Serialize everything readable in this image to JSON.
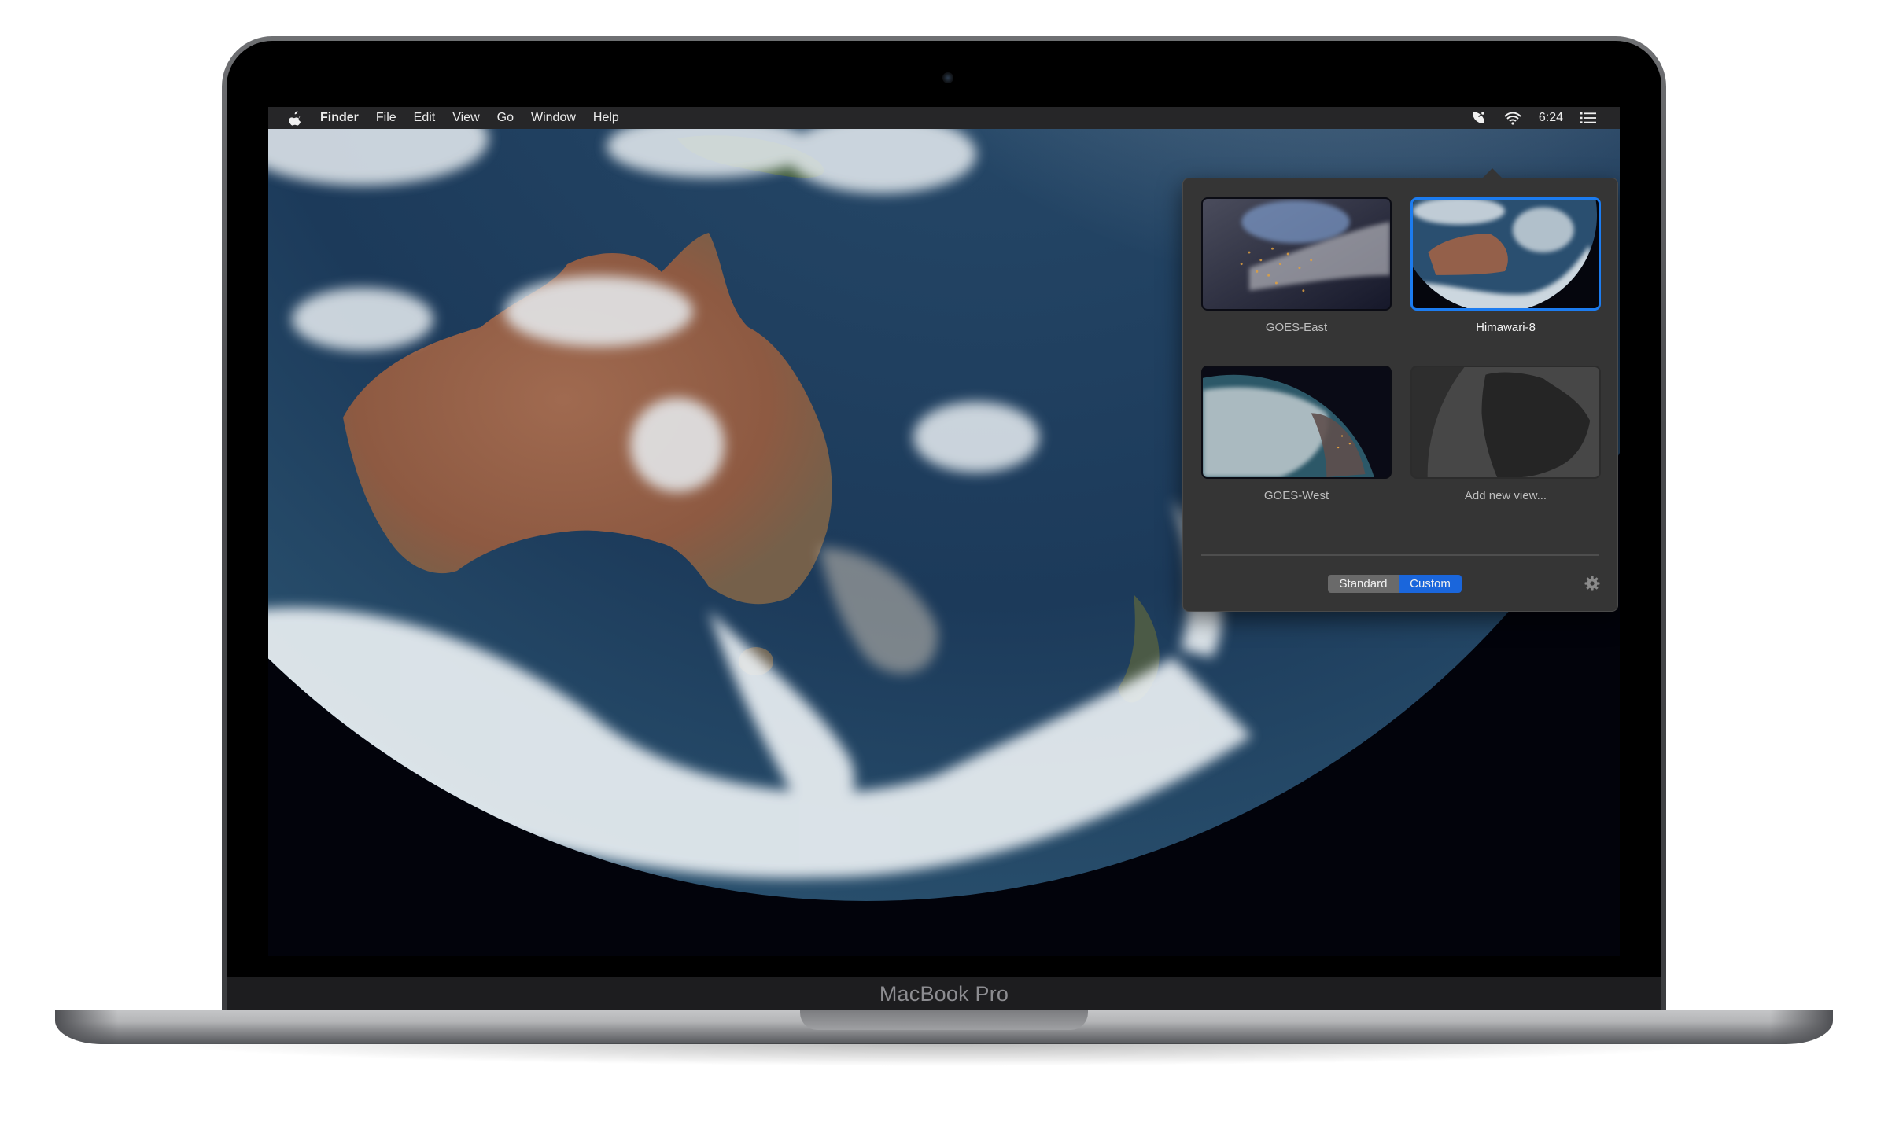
{
  "device": {
    "model_label": "MacBook Pro"
  },
  "menubar": {
    "apple_icon": "apple-logo-icon",
    "app_name": "Finder",
    "menus": [
      "File",
      "Edit",
      "View",
      "Go",
      "Window",
      "Help"
    ],
    "status_items": {
      "satellite_icon": "satellite-dish-icon",
      "wifi_icon": "wifi-icon",
      "clock": "6:24",
      "notification_icon": "notification-center-icon"
    }
  },
  "wallpaper": {
    "description": "Himawari-8 satellite view of Earth centered on Australia"
  },
  "popover": {
    "views": [
      {
        "label": "GOES-East",
        "selected": false,
        "thumbnail": "goes-east-night-north-america"
      },
      {
        "label": "Himawari-8",
        "selected": true,
        "thumbnail": "himawari-8-australia"
      },
      {
        "label": "GOES-West",
        "selected": false,
        "thumbnail": "goes-west-pacific"
      },
      {
        "label": "Add new view...",
        "selected": false,
        "thumbnail": "north-america-placeholder"
      }
    ],
    "mode_toggle": {
      "options": [
        "Standard",
        "Custom"
      ],
      "selected": "Custom"
    },
    "settings_icon": "gear-icon"
  },
  "colors": {
    "accent": "#1c7cf0",
    "segment_selected": "#1a66dc",
    "popover_bg": "#353535",
    "menubar_bg": "#262628"
  }
}
